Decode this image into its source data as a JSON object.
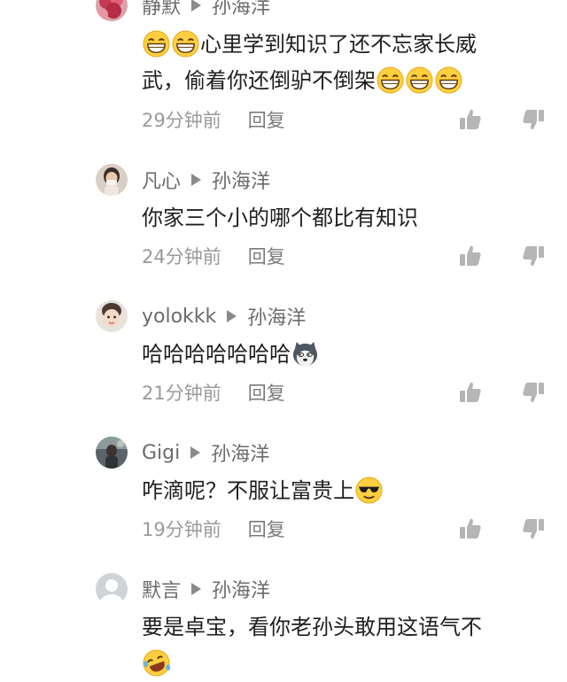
{
  "comments": [
    {
      "username": "静默",
      "reply_to": "孙海洋",
      "text_lines": [
        {
          "pre": "😁😁",
          "text": "心里学到知识了还不忘家长威"
        },
        {
          "pre": "",
          "text": "武，偷着你还倒驴不倒架",
          "post": "😁😁😁"
        }
      ],
      "time": "29分钟前",
      "reply_label": "回复",
      "avatar_icon": "flower-avatar"
    },
    {
      "username": "凡心",
      "reply_to": "孙海洋",
      "text_lines": [
        {
          "text": "你家三个小的哪个都比有知识"
        }
      ],
      "time": "24分钟前",
      "reply_label": "回复",
      "avatar_icon": "person-photo-avatar"
    },
    {
      "username": "yolokkk",
      "reply_to": "孙海洋",
      "text_lines": [
        {
          "text": "哈哈哈哈哈哈哈",
          "post_icon": "husky-dog-emoji"
        }
      ],
      "time": "21分钟前",
      "reply_label": "回复",
      "avatar_icon": "child-photo-avatar"
    },
    {
      "username": "Gigi",
      "reply_to": "孙海洋",
      "text_lines": [
        {
          "text": "咋滴呢？不服让富贵上",
          "post_icon": "sunglasses-emoji"
        }
      ],
      "time": "19分钟前",
      "reply_label": "回复",
      "avatar_icon": "dark-photo-avatar"
    },
    {
      "username": "默言",
      "reply_to": "孙海洋",
      "text_lines": [
        {
          "text": "要是卓宝，看你老孙头敢用这语气不"
        },
        {
          "post_icon": "laughing-tears-emoji"
        }
      ],
      "avatar_icon": "default-person-avatar"
    }
  ]
}
